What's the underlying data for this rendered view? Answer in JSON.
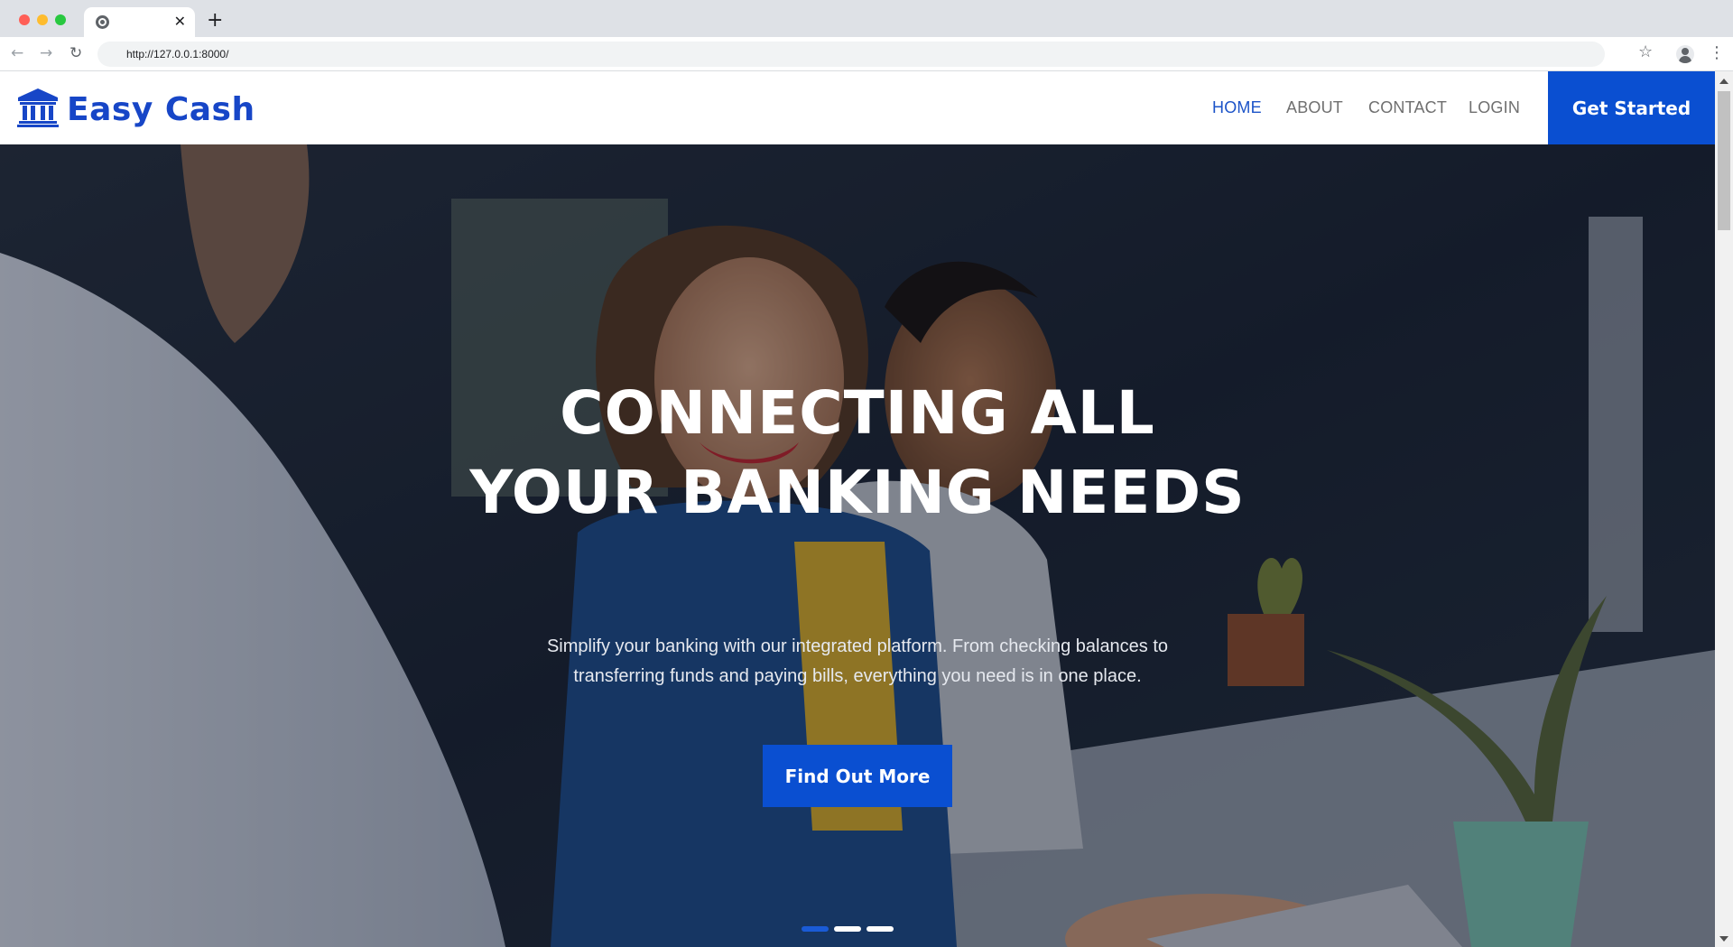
{
  "browser": {
    "tab_close": "✕",
    "new_tab": "+",
    "url": "http://127.0.0.1:8000/",
    "back": "←",
    "forward": "→",
    "reload": "↻",
    "star": "☆",
    "menu": "⋮"
  },
  "header": {
    "brand": "Easy Cash",
    "logo_icon": "bank-icon",
    "nav": {
      "home": "HOME",
      "about": "ABOUT",
      "contact": "CONTACT",
      "login": "LOGIN"
    },
    "cta": "Get Started"
  },
  "hero": {
    "title_line1": "CONNECTING ALL",
    "title_line2": "YOUR BANKING NEEDS",
    "subtitle_line1": "Simplify your banking with our integrated platform. From checking balances to",
    "subtitle_line2": "transferring funds and paying bills, everything you need is in one place.",
    "button": "Find Out More",
    "active_slide": 1,
    "slide_count": 3
  },
  "colors": {
    "brand_blue": "#1746c7",
    "button_blue": "#0a4fd1",
    "nav_active": "#1b53c8",
    "nav_inactive": "#6f6f6f"
  }
}
